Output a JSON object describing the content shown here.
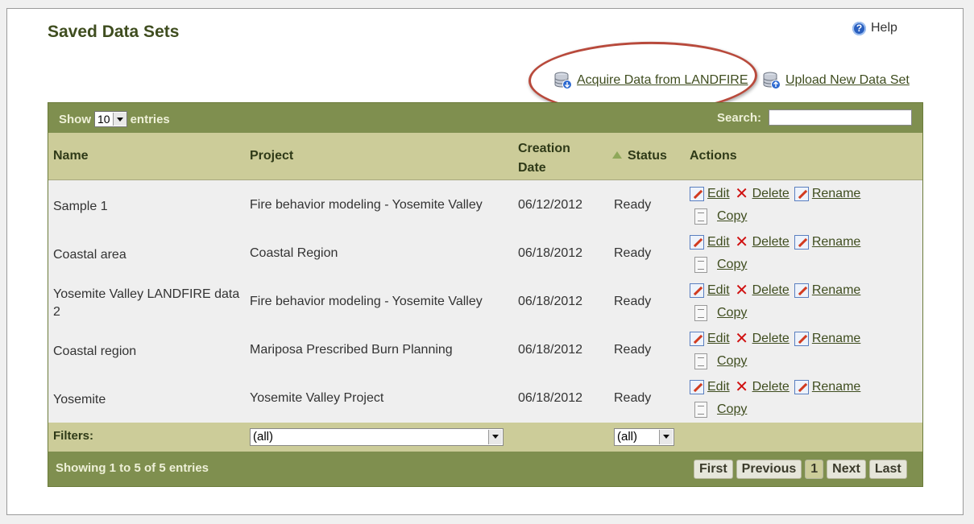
{
  "title": "Saved Data Sets",
  "help_label": "Help",
  "top_links": {
    "acquire": "Acquire Data from LANDFIRE",
    "upload": "Upload New Data Set"
  },
  "table": {
    "show_label": "Show",
    "entries_value": "10",
    "entries_label": "entries",
    "search_label": "Search:",
    "search_value": "",
    "columns": {
      "name": "Name",
      "project": "Project",
      "creation_date_1": "Creation",
      "creation_date_2": "Date",
      "status": "Status",
      "actions": "Actions"
    },
    "rows": [
      {
        "name": "Sample 1",
        "project": "Fire behavior modeling - Yosemite Valley",
        "date": "06/12/2012",
        "status": "Ready"
      },
      {
        "name": "Coastal area",
        "project": "Coastal Region",
        "date": "06/18/2012",
        "status": "Ready"
      },
      {
        "name": "Yosemite Valley LANDFIRE data 2",
        "project": "Fire behavior modeling - Yosemite Valley",
        "date": "06/18/2012",
        "status": "Ready"
      },
      {
        "name": "Coastal region",
        "project": "Mariposa Prescribed Burn Planning",
        "date": "06/18/2012",
        "status": "Ready"
      },
      {
        "name": "Yosemite",
        "project": "Yosemite Valley Project",
        "date": "06/18/2012",
        "status": "Ready"
      }
    ],
    "action_labels": {
      "edit": "Edit",
      "delete": "Delete",
      "rename": "Rename",
      "copy": "Copy"
    },
    "filters_label": "Filters:",
    "project_filter": "(all)",
    "status_filter": "(all)",
    "showing_text": "Showing 1 to 5 of 5 entries",
    "pager": {
      "first": "First",
      "previous": "Previous",
      "current": "1",
      "next": "Next",
      "last": "Last"
    }
  },
  "colors": {
    "accent_dark": "#7f8f4f",
    "accent_light": "#cccc99",
    "highlight": "#b84a3c"
  }
}
